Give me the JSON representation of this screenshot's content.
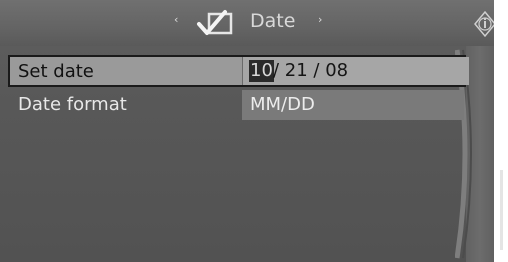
{
  "header": {
    "title": "Date",
    "nav_left": "‹",
    "nav_right": "›",
    "icons": {
      "settings": "checkmark-box-icon",
      "info": "info-icon"
    }
  },
  "menu": {
    "rows": [
      {
        "label": "Set date",
        "value_month": "10",
        "value_rest": "/ 21 / 08"
      },
      {
        "label": "Date format",
        "value": "MM/DD"
      }
    ]
  },
  "colors": {
    "screen_bg": "#585858",
    "selected_row": "#9a9a9a",
    "selected_border": "#1a1a1a",
    "cursor_bg": "#2a2a2a",
    "text_light": "#e8e8e8",
    "text_dark": "#111111"
  }
}
